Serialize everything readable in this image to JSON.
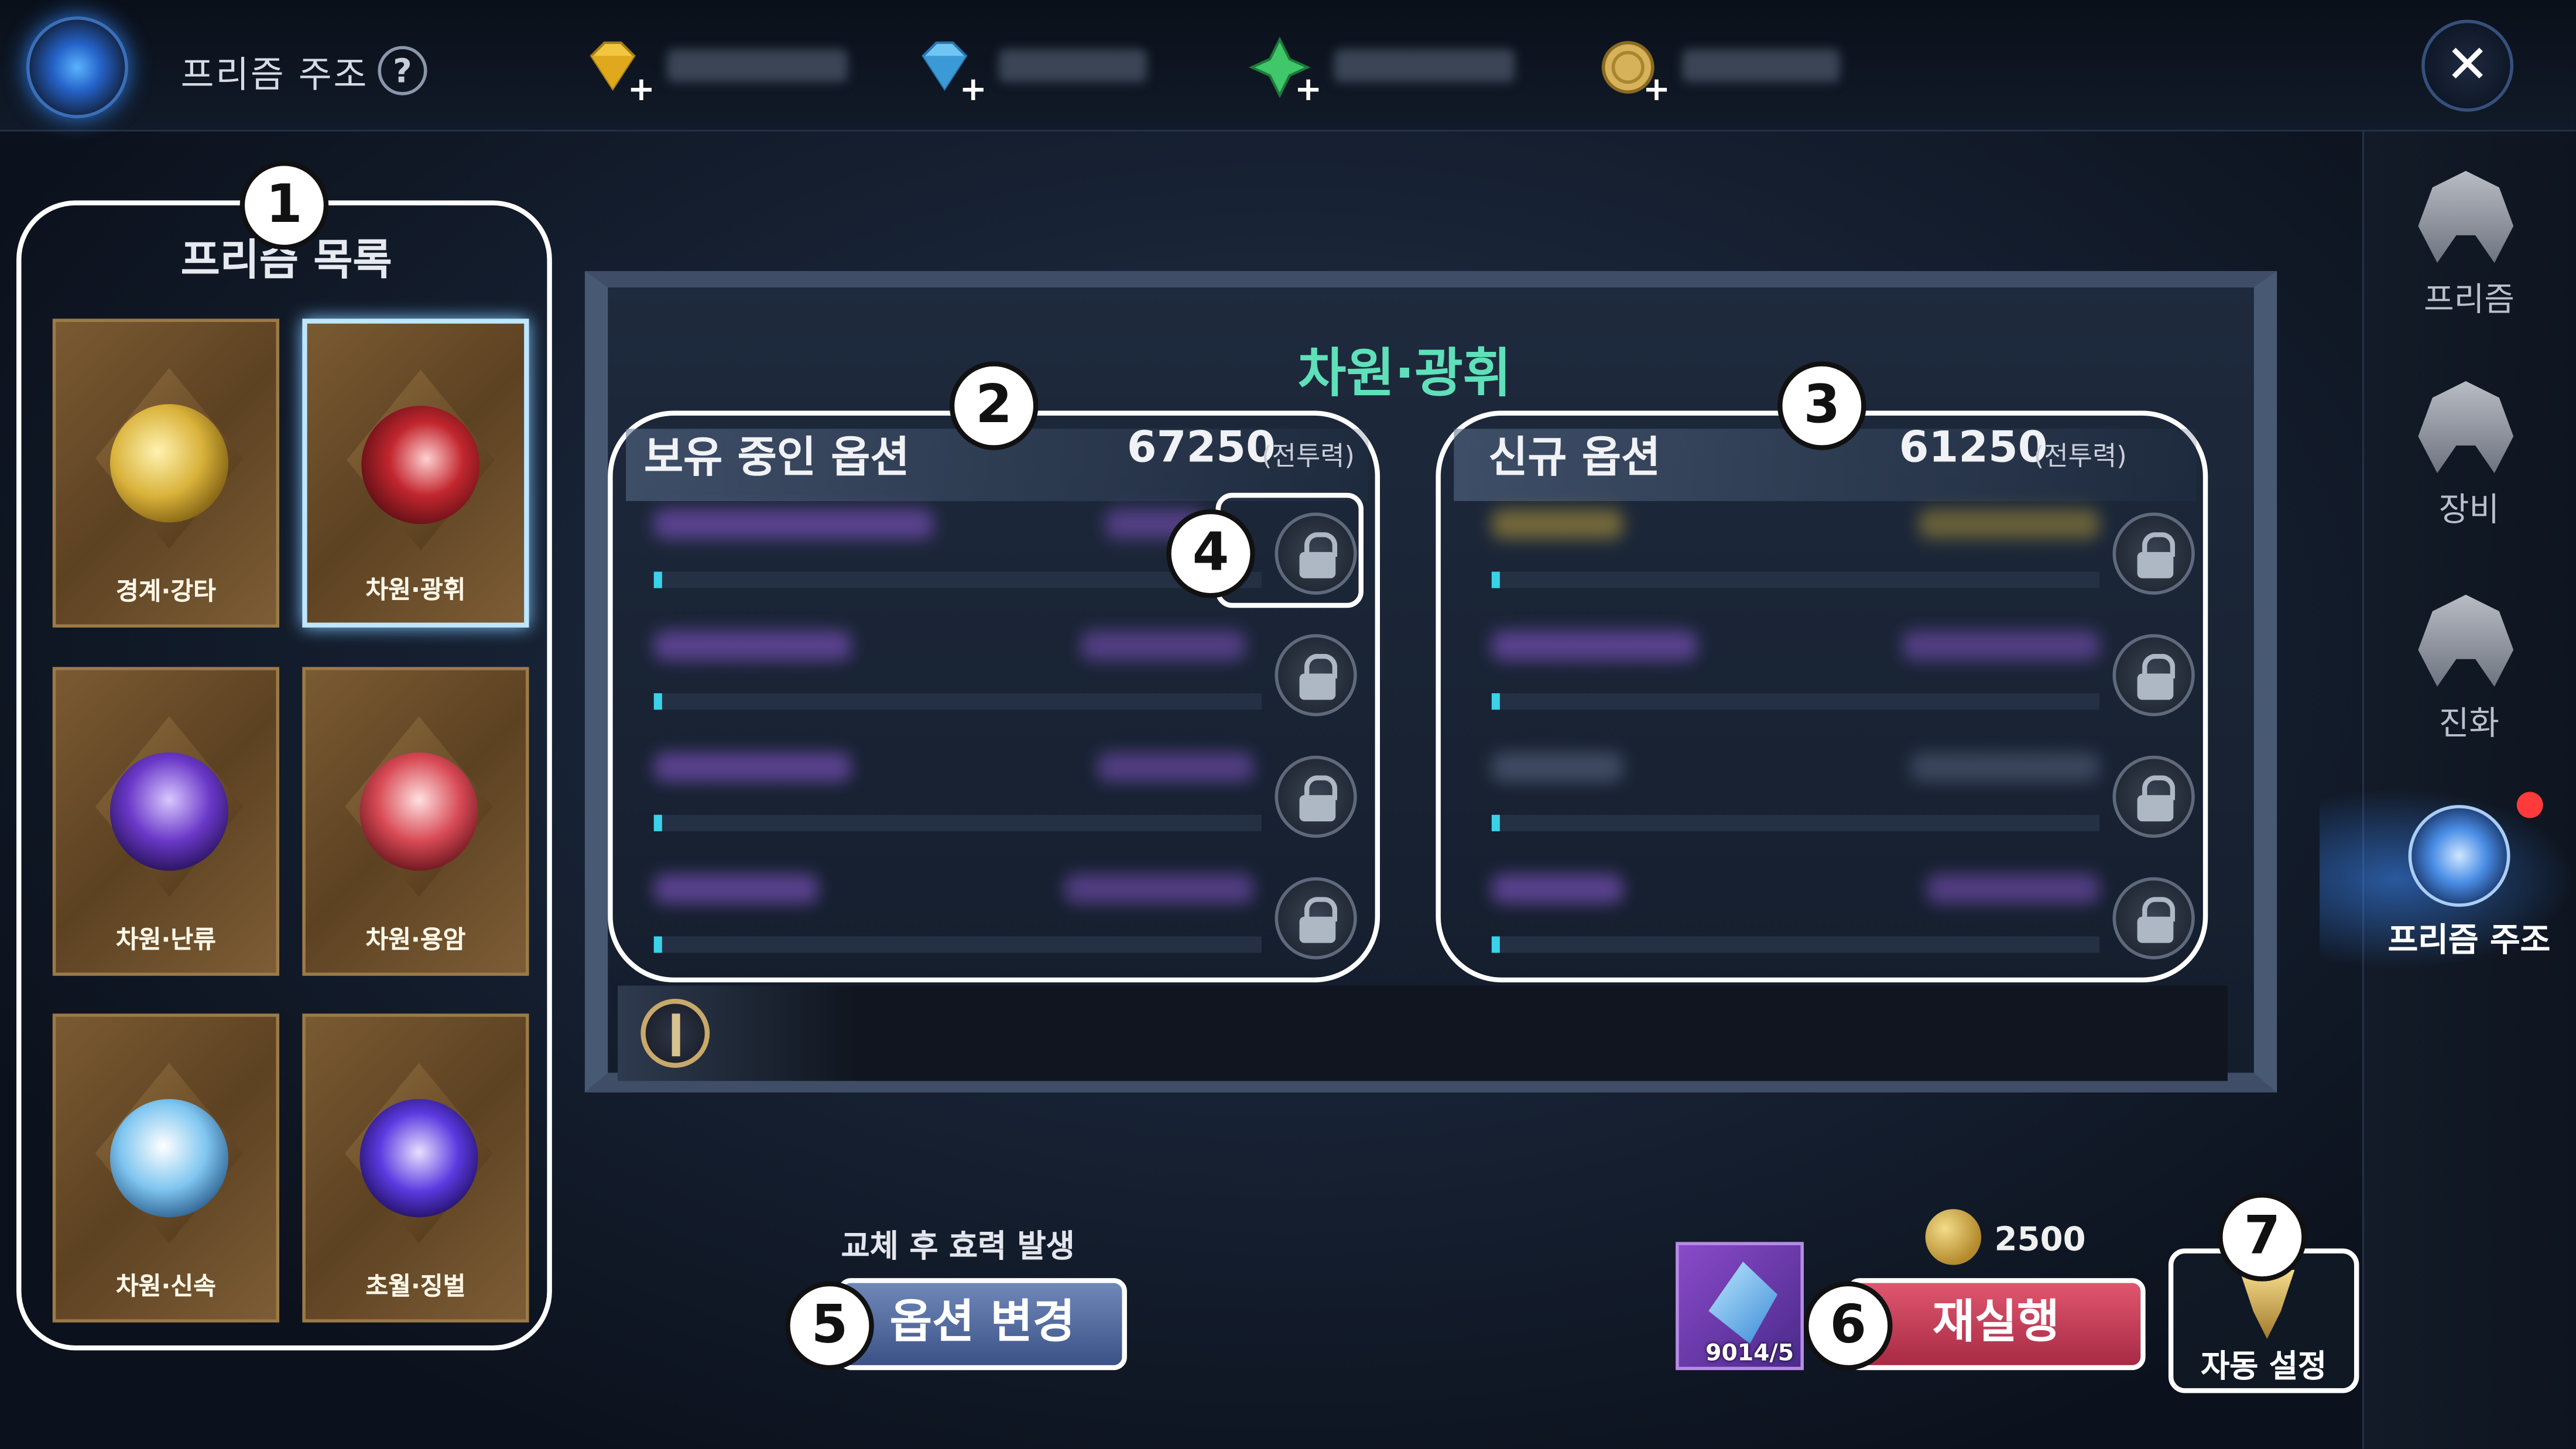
{
  "header": {
    "title": "프리즘 주조",
    "help_label": "?",
    "currencies": [
      {
        "icon": "yellow-diamond-icon",
        "plus": "+",
        "value": ""
      },
      {
        "icon": "blue-diamond-icon",
        "plus": "+",
        "value": ""
      },
      {
        "icon": "green-gem-icon",
        "plus": "+",
        "value": ""
      },
      {
        "icon": "gold-coin-icon",
        "plus": "+",
        "value": ""
      }
    ],
    "close_label": "✕"
  },
  "prism_list": {
    "title": "프리즘 목록",
    "items": [
      {
        "name": "경계·강타",
        "orb_color": "#d9b23a",
        "selected": false
      },
      {
        "name": "차원·광휘",
        "orb_color": "#c2262e",
        "selected": true
      },
      {
        "name": "차원·난류",
        "orb_color": "#6a38c8",
        "selected": false
      },
      {
        "name": "차원·용암",
        "orb_color": "#d84a55",
        "selected": false
      },
      {
        "name": "차원·신속",
        "orb_color": "#7fc6f0",
        "selected": false
      },
      {
        "name": "초월·징벌",
        "orb_color": "#5a3ae0",
        "selected": false
      }
    ]
  },
  "main": {
    "prism_name": "차원·광휘",
    "current_options": {
      "title": "보유 중인 옵션",
      "power": "67250",
      "power_unit": "(전투력)",
      "rows": 4
    },
    "new_options": {
      "title": "신규 옵션",
      "power": "61250",
      "power_unit": "(전투력)",
      "rows": 4
    }
  },
  "actions": {
    "change_hint": "교체 후 효력 발생",
    "change_button": "옵션 변경",
    "item_count": "9014/5",
    "cost": "2500",
    "retry_button": "재실행",
    "auto_button": "자동 설정"
  },
  "sidebar": {
    "items": [
      {
        "label": "프리즘"
      },
      {
        "label": "장비"
      },
      {
        "label": "진화"
      },
      {
        "label": "프리즘 주조"
      }
    ]
  },
  "callouts": [
    "1",
    "2",
    "3",
    "4",
    "5",
    "6",
    "7"
  ],
  "colors": {
    "accent_green": "#5fe0b9",
    "retry_red": "#c43a55",
    "change_blue": "#4f68a0",
    "bar_fill": "#3ad2e8"
  }
}
